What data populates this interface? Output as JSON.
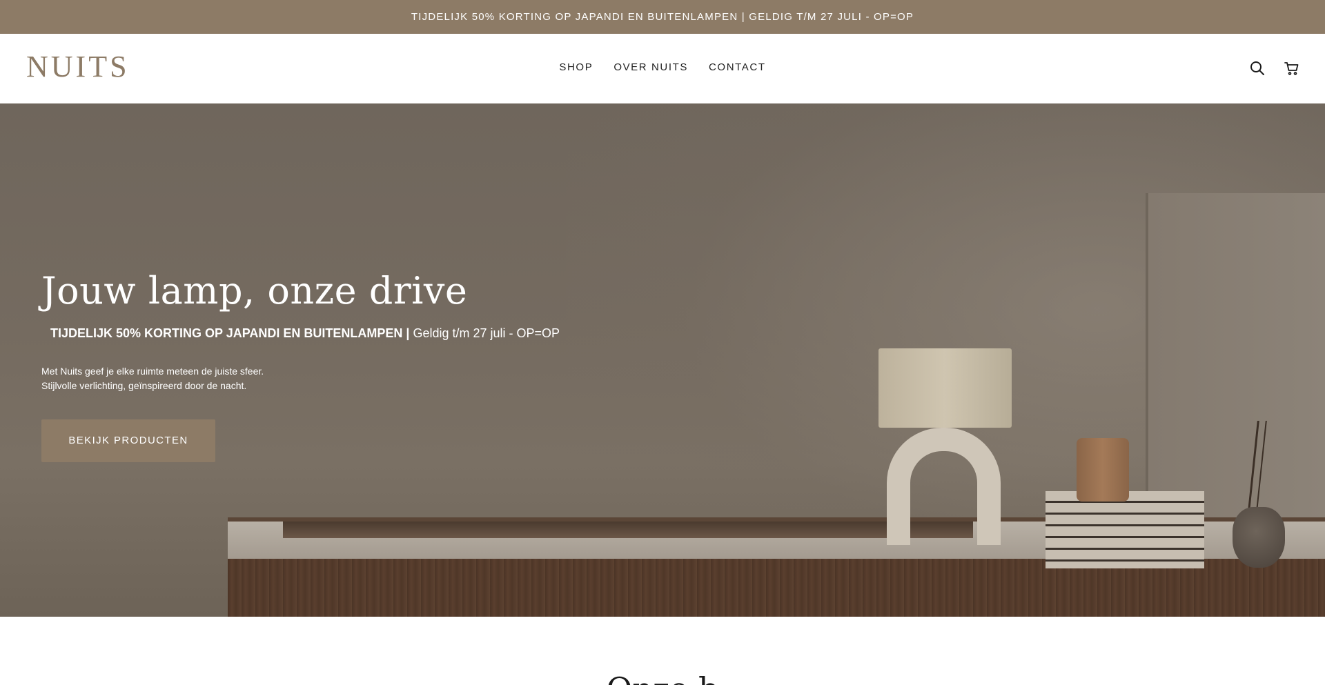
{
  "announcement": {
    "text": "TIJDELIJK 50% KORTING OP JAPANDI EN BUITENLAMPEN | GELDIG T/M 27 JULI - OP=OP"
  },
  "header": {
    "logo_text": "NUITS",
    "nav": [
      {
        "label": "SHOP"
      },
      {
        "label": "OVER NUITS"
      },
      {
        "label": "CONTACT"
      }
    ],
    "icons": [
      "search-icon",
      "cart-icon"
    ]
  },
  "hero": {
    "title": "Jouw lamp, onze drive",
    "promo_bold": "TIJDELIJK 50% KORTING OP JAPANDI EN BUITENLAMPEN |",
    "promo_regular": "Geldig t/m 27 juli - OP=OP",
    "text_line1": "Met Nuits geef je elke ruimte meteen de juiste sfeer.",
    "text_line2": "Stijlvolle verlichting, geïnspireerd door de nacht.",
    "button_label": "BEKIJK PRODUCTEN"
  },
  "next_section": {
    "heading_partial": "Onze b"
  },
  "colors": {
    "brand": "#8d7b66",
    "text_dark": "#1a1a1a",
    "white": "#ffffff"
  }
}
